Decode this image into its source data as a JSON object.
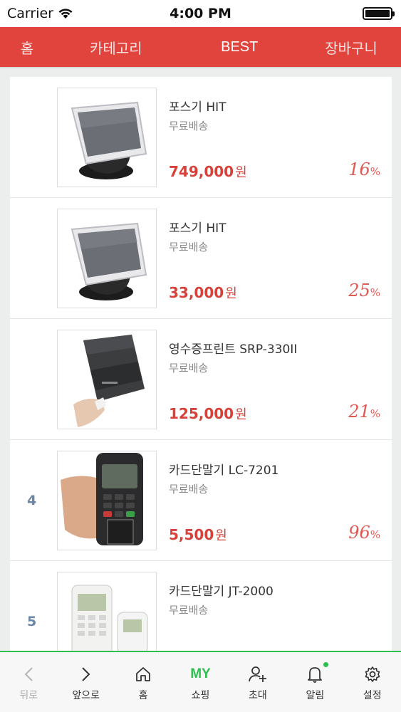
{
  "status": {
    "carrier": "Carrier",
    "time": "4:00 PM"
  },
  "topnav": [
    {
      "label": "홈"
    },
    {
      "label": "카테고리"
    },
    {
      "label": "BEST",
      "active": true
    },
    {
      "label": "장바구니"
    }
  ],
  "products": [
    {
      "rank": "",
      "name": "포스기 HIT",
      "shipping": "무료배송",
      "price": "749,000",
      "currency": "원",
      "discount": "16",
      "percent": "%",
      "image": "pos-terminal-image"
    },
    {
      "rank": "",
      "name": "포스기 HIT",
      "shipping": "무료배송",
      "price": "33,000",
      "currency": "원",
      "discount": "25",
      "percent": "%",
      "image": "pos-terminal-image"
    },
    {
      "rank": "",
      "name": "영수증프린트 SRP-330II",
      "shipping": "무료배송",
      "price": "125,000",
      "currency": "원",
      "discount": "21",
      "percent": "%",
      "image": "receipt-printer-image"
    },
    {
      "rank": "4",
      "name": "카드단말기 LC-7201",
      "shipping": "무료배송",
      "price": "5,500",
      "currency": "원",
      "discount": "96",
      "percent": "%",
      "image": "card-terminal-image"
    },
    {
      "rank": "5",
      "name": "카드단말기 JT-2000",
      "shipping": "무료배송",
      "price": "",
      "currency": "",
      "discount": "",
      "percent": "",
      "image": "card-terminal-white-image"
    }
  ],
  "tabbar": [
    {
      "label": "뒤로",
      "icon": "back-chevron-icon",
      "disabled": true
    },
    {
      "label": "앞으로",
      "icon": "forward-chevron-icon"
    },
    {
      "label": "홈",
      "icon": "home-icon"
    },
    {
      "label": "쇼핑",
      "icon": "my-shopping-icon",
      "icon_text": "MY"
    },
    {
      "label": "초대",
      "icon": "invite-user-icon"
    },
    {
      "label": "알림",
      "icon": "bell-icon"
    },
    {
      "label": "설정",
      "icon": "gear-icon"
    }
  ],
  "colors": {
    "accent": "#e0443c",
    "price": "#d8403a",
    "tab_accent": "#2fbf4f",
    "rank": "#6b86a6"
  }
}
